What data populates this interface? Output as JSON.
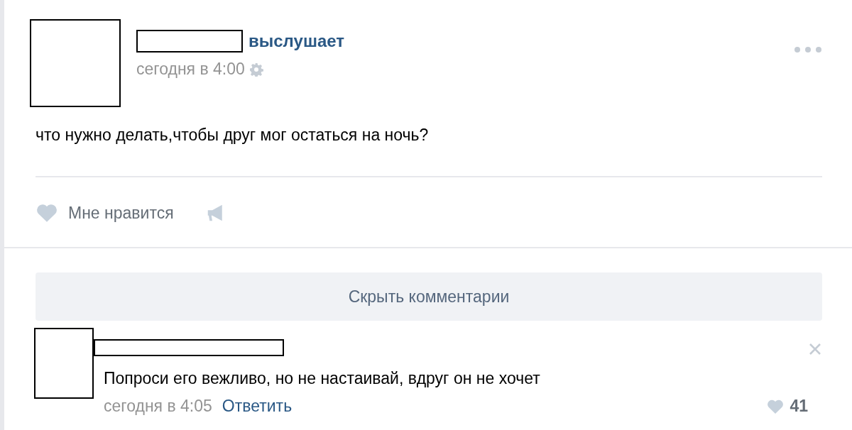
{
  "post": {
    "author_action": "выслушает",
    "time": "сегодня в 4:00",
    "text": "что нужно делать,чтобы друг мог остаться на ночь?",
    "like_label": "Мне нравится",
    "liked": false
  },
  "comments_toggle": "Скрыть комментарии",
  "comments": [
    {
      "text": "Попроси его вежливо, но не настаивай, вдруг он не хочет",
      "time": "сегодня в 4:05",
      "reply_label": "Ответить",
      "likes": "41",
      "liked": false
    }
  ]
}
